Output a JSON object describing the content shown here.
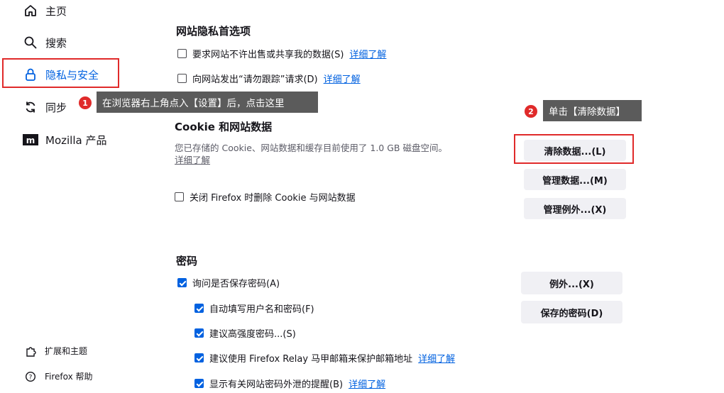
{
  "sidebar": {
    "items": [
      {
        "label": "主页",
        "icon": "home-icon"
      },
      {
        "label": "搜索",
        "icon": "search-icon"
      },
      {
        "label": "隐私与安全",
        "icon": "lock-icon"
      },
      {
        "label": "同步",
        "icon": "sync-icon"
      },
      {
        "label": "Mozilla 产品",
        "icon": "mozilla-icon"
      }
    ],
    "footer": [
      {
        "label": "扩展和主题",
        "icon": "puzzle-icon"
      },
      {
        "label": "Firefox 帮助",
        "icon": "help-icon"
      }
    ]
  },
  "privacy_prefs": {
    "title": "网站隐私首选项",
    "items": [
      {
        "label": "要求网站不许出售或共享我的数据(S)",
        "link": "详细了解",
        "checked": false
      },
      {
        "label": "向网站发出“请勿跟踪”请求(D)",
        "link": "详细了解",
        "checked": false
      }
    ]
  },
  "cookies": {
    "title": "Cookie 和网站数据",
    "description": "您已存储的 Cookie、网站数据和缓存目前使用了 1.0 GB 磁盘空间。",
    "learn_more": "详细了解",
    "delete_on_close": "关闭 Firefox 时删除 Cookie 与网站数据",
    "buttons": {
      "clear": "清除数据...(L)",
      "manage": "管理数据...(M)",
      "exceptions": "管理例外...(X)"
    }
  },
  "passwords": {
    "title": "密码",
    "ask_save": "询问是否保存密码(A)",
    "autofill": "自动填写用户名和密码(F)",
    "suggest_strong": "建议高强度密码...(S)",
    "relay": "建议使用 Firefox Relay 马甲邮箱来保护邮箱地址",
    "relay_link": "详细了解",
    "breach_alerts": "显示有关网站密码外泄的提醒(B)",
    "breach_link": "详细了解",
    "buttons": {
      "exceptions": "例外...(X)",
      "saved": "保存的密码(D)"
    }
  },
  "annotations": {
    "step1_num": "1",
    "step1_text": "在浏览器右上角点入【设置】后，点击这里",
    "step2_num": "2",
    "step2_text": "单击【清除数据】"
  },
  "colors": {
    "accent": "#0061e0",
    "highlight": "#e02a2a",
    "callout_bg": "#5b5b5b"
  }
}
